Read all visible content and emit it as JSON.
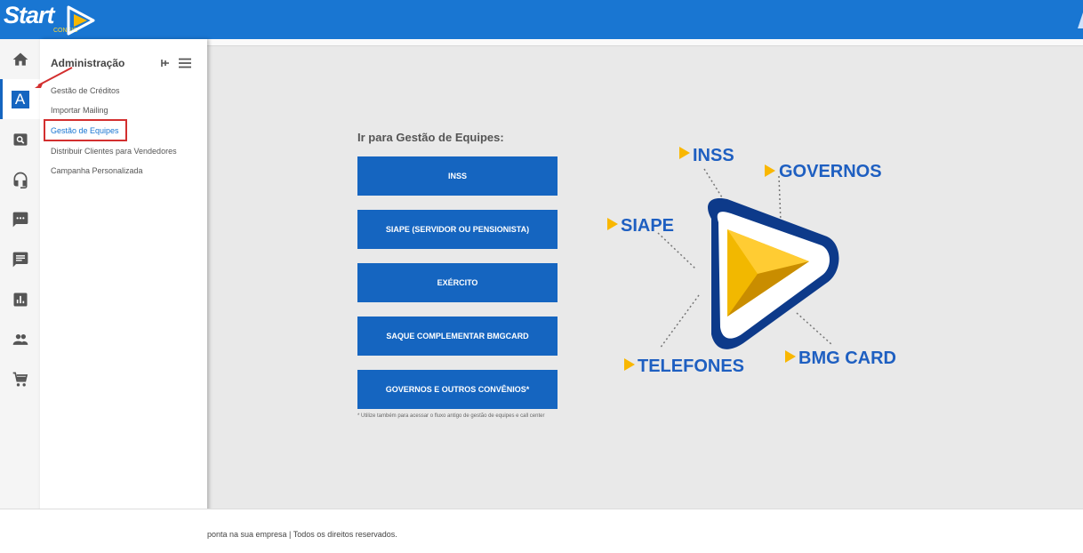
{
  "header": {
    "logo_text": "Start",
    "logo_sub": "CONSIG"
  },
  "rail": {
    "items": [
      {
        "name": "home"
      },
      {
        "name": "administracao",
        "letter": "A"
      },
      {
        "name": "search"
      },
      {
        "name": "headset"
      },
      {
        "name": "chat"
      },
      {
        "name": "message"
      },
      {
        "name": "reports"
      },
      {
        "name": "people"
      },
      {
        "name": "cart"
      }
    ]
  },
  "flyout": {
    "title": "Administração",
    "items": [
      {
        "label": "Gestão de Créditos"
      },
      {
        "label": "Importar Mailing"
      },
      {
        "label": "Gestão de Equipes"
      },
      {
        "label": "Distribuir Clientes para Vendedores"
      },
      {
        "label": "Campanha Personalizada"
      }
    ]
  },
  "main": {
    "title": "Ir para Gestão de Equipes:",
    "buttons": [
      {
        "label": "INSS"
      },
      {
        "label": "SIAPE (SERVIDOR OU PENSIONISTA)"
      },
      {
        "label": "EXÉRCITO"
      },
      {
        "label": "SAQUE COMPLEMENTAR BMGCARD"
      },
      {
        "label": "GOVERNOS E OUTROS CONVÊNIOS*"
      }
    ],
    "footnote": "* Utilize também para acessar o fluxo antigo de gestão de equipes e call center"
  },
  "illustration": {
    "labels": {
      "inss": "INSS",
      "governos": "GOVERNOS",
      "siape": "SIAPE",
      "telefones": "TELEFONES",
      "bmg_card": "BMG CARD"
    }
  },
  "footer": {
    "text": "ponta na sua empresa | Todos os direitos reservados."
  },
  "colors": {
    "primary": "#1976d2",
    "button": "#1565c0",
    "accent": "#f9b700",
    "navy": "#0d3a8a",
    "highlight": "#d32f2f"
  }
}
